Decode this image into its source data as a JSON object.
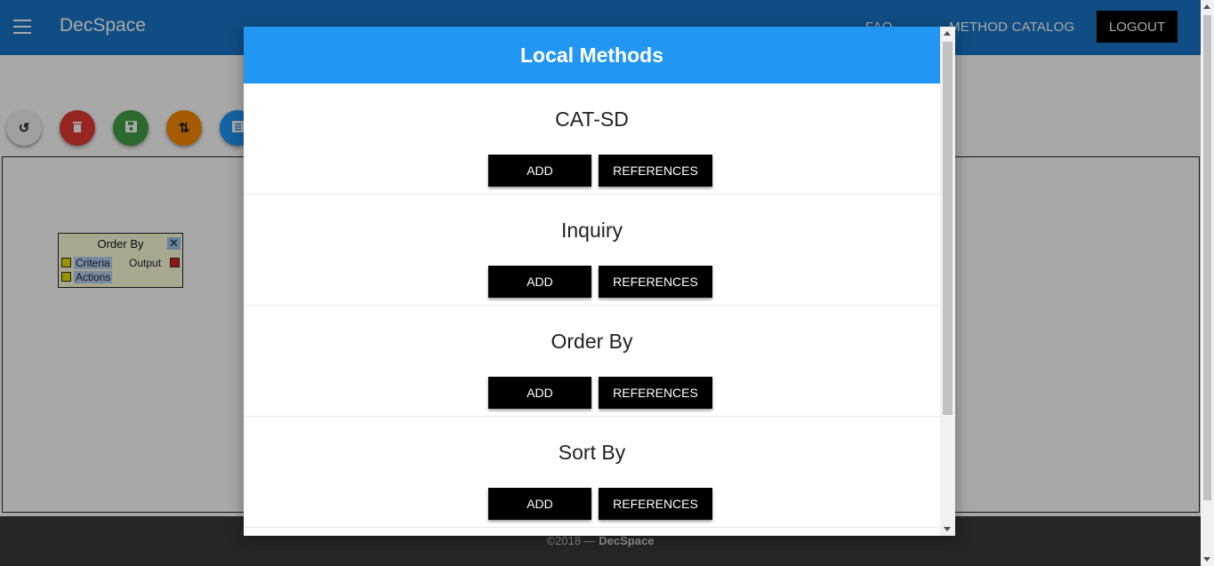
{
  "header": {
    "brand": "DecSpace",
    "nav": {
      "faq": "FAQ",
      "catalog": "METHOD CATALOG",
      "logout": "LOGOUT"
    }
  },
  "toolbar": {
    "icons": [
      "undo-icon",
      "delete-icon",
      "save-icon",
      "sort-icon",
      "document-icon"
    ]
  },
  "node": {
    "title": "Order By",
    "close": "✕",
    "inputs": [
      "Criteria",
      "Actions"
    ],
    "output": "Output"
  },
  "footer": {
    "prefix": "©2018 — ",
    "brand": "DecSpace"
  },
  "modal": {
    "title": "Local Methods",
    "add_label": "ADD",
    "ref_label": "REFERENCES",
    "methods": [
      {
        "name": "CAT-SD"
      },
      {
        "name": "Inquiry"
      },
      {
        "name": "Order By"
      },
      {
        "name": "Sort By"
      }
    ]
  },
  "colors": {
    "header_bg": "#1976c8",
    "modal_header_bg": "#2196f3",
    "button_bg": "#000000",
    "footer_bg": "#3a3a3a"
  }
}
